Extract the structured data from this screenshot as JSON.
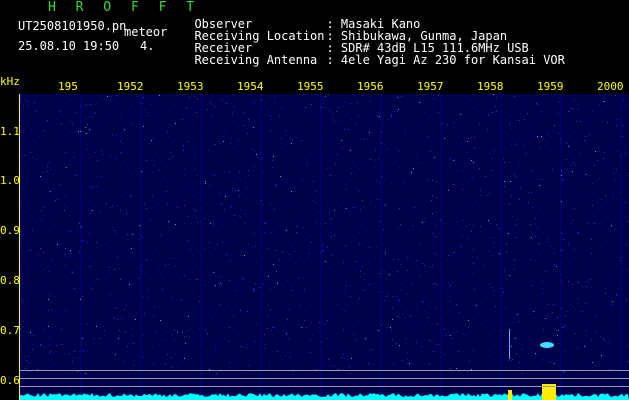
{
  "header": {
    "app_name": "H R O F F T",
    "file_name": "UT2508101950.pn",
    "meteor_label": "meteor",
    "datetime": "25.08.10 19:50",
    "count": "4.",
    "fields": [
      {
        "key": "Observer",
        "value": ": Masaki Kano"
      },
      {
        "key": "Receiving Location",
        "value": ": Shibukawa, Gunma, Japan"
      },
      {
        "key": "Receiver",
        "value": ": SDR# 43dB L15 111.6MHz USB"
      },
      {
        "key": "Receiving Antenna",
        "value": ": 4ele Yagi Az 230 for Kansai VOR"
      }
    ]
  },
  "axes": {
    "y_unit": "kHz",
    "y_ticks": [
      "1.1",
      "1.0",
      "0.9",
      "0.8",
      "0.7",
      "0.6"
    ],
    "x_ticks": [
      "195",
      "1952",
      "1953",
      "1954",
      "1955",
      "1956",
      "1957",
      "1958",
      "1959",
      "2000"
    ]
  },
  "colors": {
    "background": "#00004a",
    "axis": "#ffff00",
    "signal": "#00ffff",
    "title_green": "#33dd33"
  }
}
